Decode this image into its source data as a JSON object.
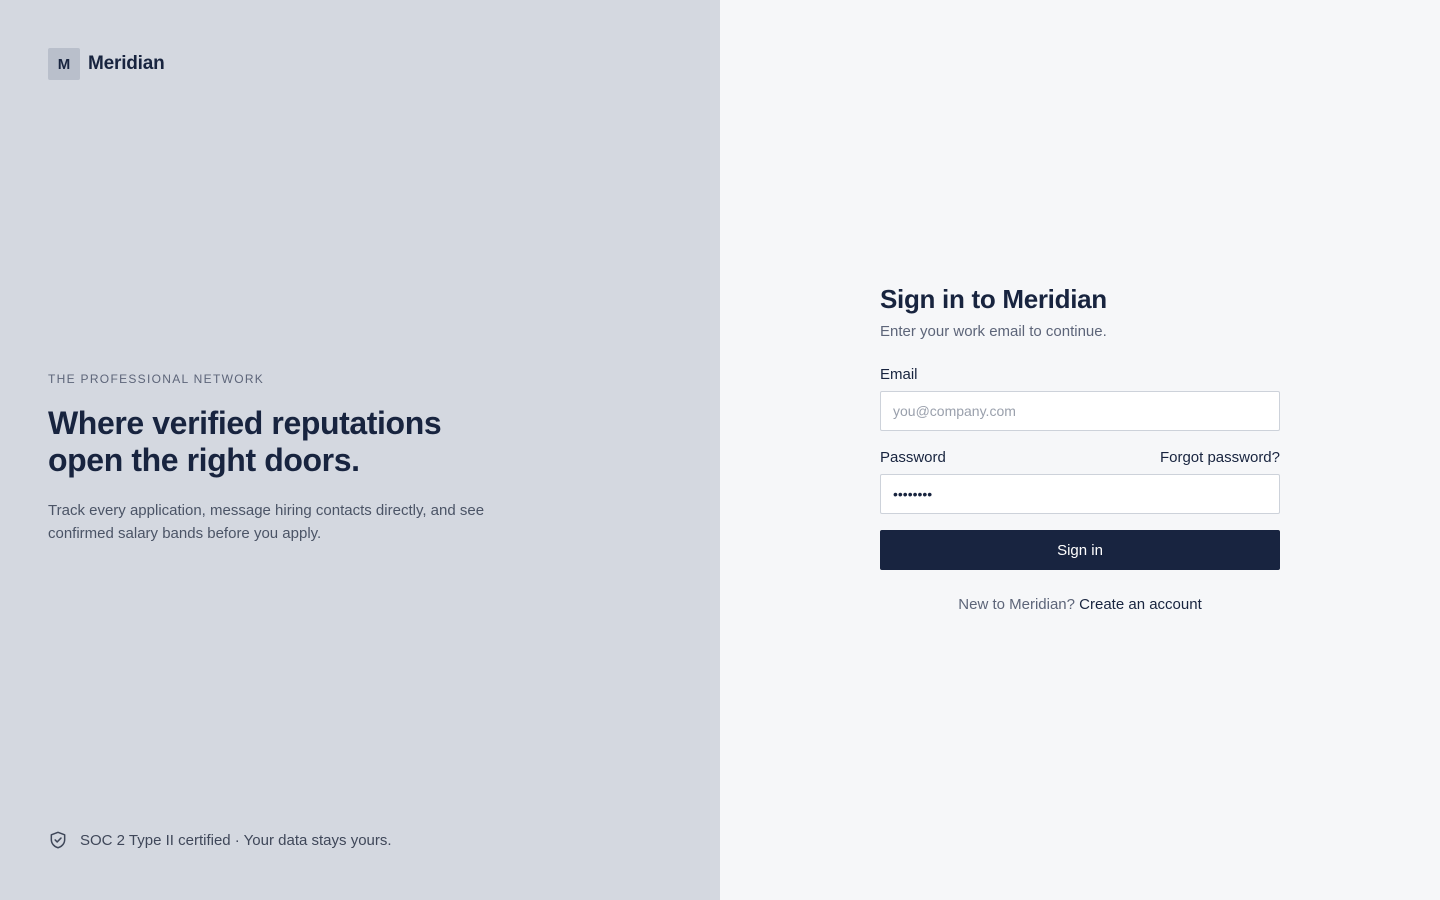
{
  "brand": {
    "mark": "M",
    "name": "Meridian"
  },
  "hero": {
    "eyebrow": "THE PROFESSIONAL NETWORK",
    "headline": "Where verified reputations open the right doors.",
    "subhead": "Track every application, message hiring contacts directly, and see confirmed salary bands before you apply."
  },
  "compliance": {
    "icon": "shield-check-icon",
    "text": "SOC 2 Type II certified · Your data stays yours."
  },
  "form": {
    "title": "Sign in to Meridian",
    "subtitle": "Enter your work email to continue.",
    "email_label": "Email",
    "email_placeholder": "you@company.com",
    "email_value": "",
    "password_label": "Password",
    "forgot_label": "Forgot password?",
    "password_value": "••••••••",
    "submit_label": "Sign in",
    "signup_prompt": "New to Meridian?",
    "signup_link": "Create an account"
  },
  "colors": {
    "left_panel_bg": "#d4d8e0",
    "right_panel_bg": "#f6f7f9",
    "primary": "#182440",
    "text_primary": "#18243f",
    "text_muted": "#5d6579"
  }
}
